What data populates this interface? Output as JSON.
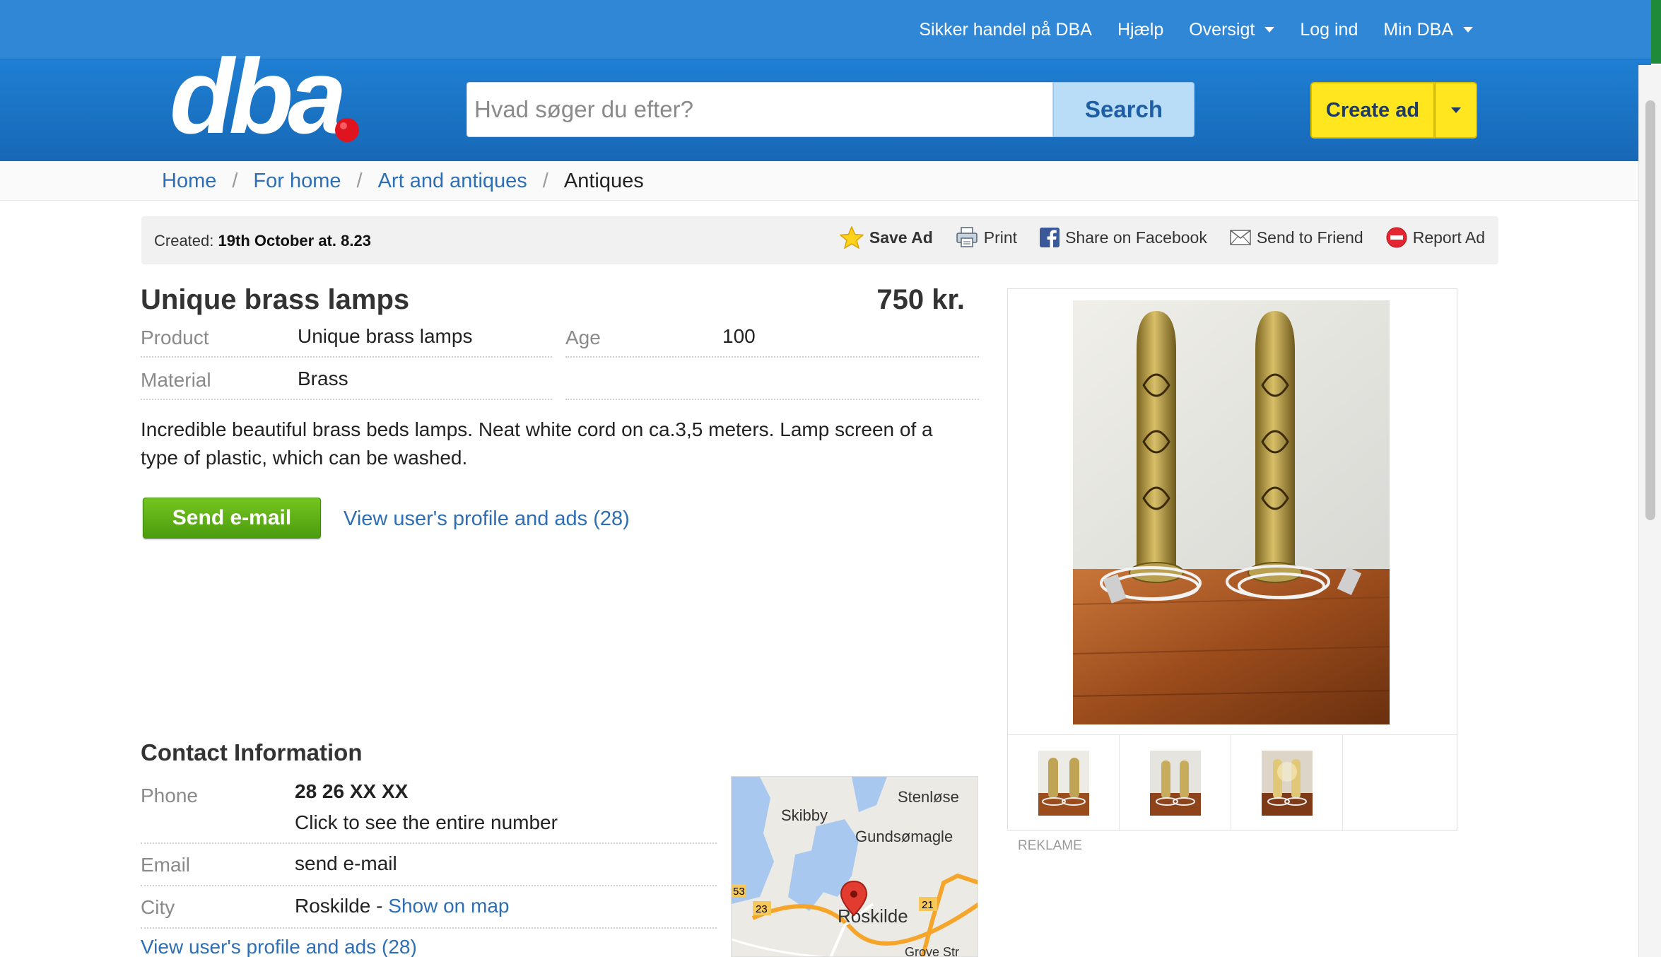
{
  "topnav": {
    "safe_trade": "Sikker handel på DBA",
    "help": "Hjælp",
    "overview": "Oversigt",
    "login": "Log ind",
    "my_dba": "Min DBA"
  },
  "header": {
    "logo_text": "dba",
    "search_placeholder": "Hvad søger du efter?",
    "search_button": "Search",
    "create_ad": "Create ad"
  },
  "breadcrumb": {
    "items": [
      "Home",
      "For home",
      "Art and antiques",
      "Antiques"
    ],
    "separator": "/"
  },
  "toolbar": {
    "created_label": "Created:",
    "created_value": "19th October at. 8.23",
    "save_ad": "Save Ad",
    "print": "Print",
    "share_facebook": "Share on Facebook",
    "send_friend": "Send to Friend",
    "report_ad": "Report Ad"
  },
  "listing": {
    "title": "Unique brass lamps",
    "price": "750 kr.",
    "attributes": {
      "product_label": "Product",
      "product_value": "Unique brass lamps",
      "age_label": "Age",
      "age_value": "100",
      "material_label": "Material",
      "material_value": "Brass"
    },
    "description_line1": "Incredible beautiful brass beds lamps. Neat white cord on ca.3,5 meters. Lamp screen of a",
    "description_line2": "type of plastic, which can be washed.",
    "send_email_button": "Send e-mail",
    "profile_link": "View user's profile and ads (28)"
  },
  "contact": {
    "heading": "Contact Information",
    "phone_label": "Phone",
    "phone_value": "28 26 XX XX",
    "phone_reveal": "Click to see the entire number",
    "email_label": "Email",
    "email_value": "send e-mail",
    "city_label": "City",
    "city_value": "Roskilde - ",
    "show_on_map": "Show on map",
    "profile_link": "View user's profile and ads (28)"
  },
  "map": {
    "labels": [
      "Skibby",
      "Stenløse",
      "Gundsømagle",
      "Roskilde",
      "Grove Str"
    ],
    "road_numbers": [
      "53",
      "23",
      "21"
    ]
  },
  "ad": {
    "reklame": "REKLAME"
  },
  "colors": {
    "header_blue": "#1f7fd3",
    "link_blue": "#2d6eb5",
    "create_yellow": "#ffe61f",
    "send_green": "#5aab14"
  }
}
